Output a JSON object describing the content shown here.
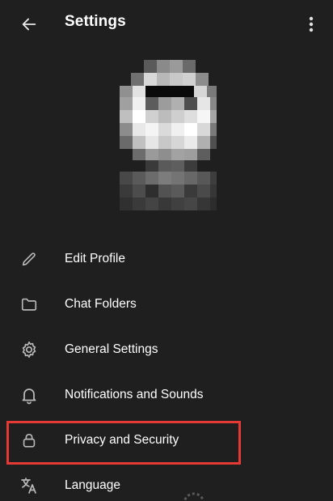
{
  "header": {
    "title": "Settings",
    "back_icon": "arrow-left-icon",
    "menu_icon": "more-vertical-icon"
  },
  "menu": {
    "items": [
      {
        "label": "Edit Profile",
        "icon": "pencil-icon"
      },
      {
        "label": "Chat Folders",
        "icon": "folder-icon"
      },
      {
        "label": "General Settings",
        "icon": "gear-icon"
      },
      {
        "label": "Notifications and Sounds",
        "icon": "bell-icon"
      },
      {
        "label": "Privacy and Security",
        "icon": "lock-icon",
        "highlighted": true
      },
      {
        "label": "Language",
        "icon": "translate-icon"
      }
    ]
  },
  "colors": {
    "background": "#1f1f20",
    "text": "#ffffff",
    "icon": "#b8b8b8",
    "highlight": "#e53935"
  }
}
